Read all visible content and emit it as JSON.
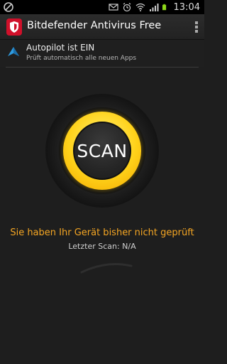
{
  "status_bar": {
    "time": "13:04",
    "icons": [
      "blocked-circle-icon",
      "email-icon",
      "alarm-icon",
      "wifi-icon",
      "signal-icon",
      "battery-icon"
    ]
  },
  "action_bar": {
    "title": "Bitdefender Antivirus Free",
    "app_icon": "bitdefender-shield-icon",
    "menu_icon": "overflow-menu-icon"
  },
  "autopilot": {
    "icon": "autopilot-arrow-icon",
    "title": "Autopilot ist EIN",
    "subtitle": "Prüft automatisch alle neuen Apps"
  },
  "scan": {
    "button_label": "SCAN",
    "message": "Sie haben Ihr Gerät bisher nicht geprüft",
    "last_scan": "Letzter Scan: N/A"
  },
  "colors": {
    "background": "#1e1e1e",
    "ring": "#ffd21a",
    "message": "#f5a623",
    "brand_red": "#d0102a",
    "autopilot_blue": "#2f9be0"
  }
}
